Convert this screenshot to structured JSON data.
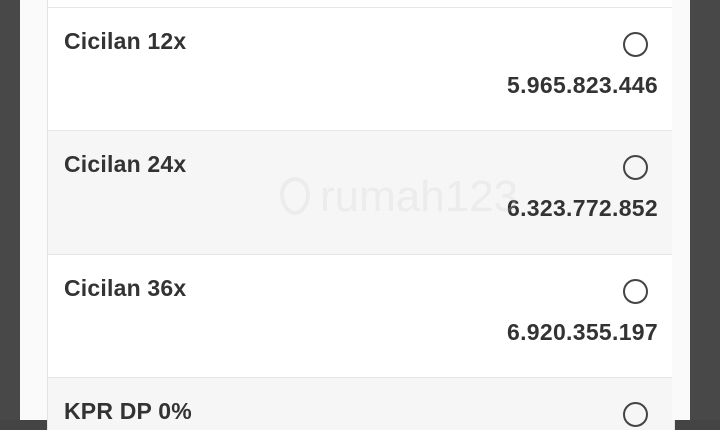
{
  "options": [
    {
      "label": "Cicilan 12x",
      "amount": "5.965.823.446",
      "selected": false
    },
    {
      "label": "Cicilan 24x",
      "amount": "6.323.772.852",
      "selected": false
    },
    {
      "label": "Cicilan 36x",
      "amount": "6.920.355.197",
      "selected": false
    },
    {
      "label": "KPR DP 0%",
      "amount": "",
      "selected": false
    }
  ],
  "watermark": {
    "text": "rumah123",
    "icon": "rumah123-logo-icon"
  },
  "colors": {
    "text": "#333333",
    "row_alt": "#f6f6f6",
    "frame": "#484848"
  }
}
